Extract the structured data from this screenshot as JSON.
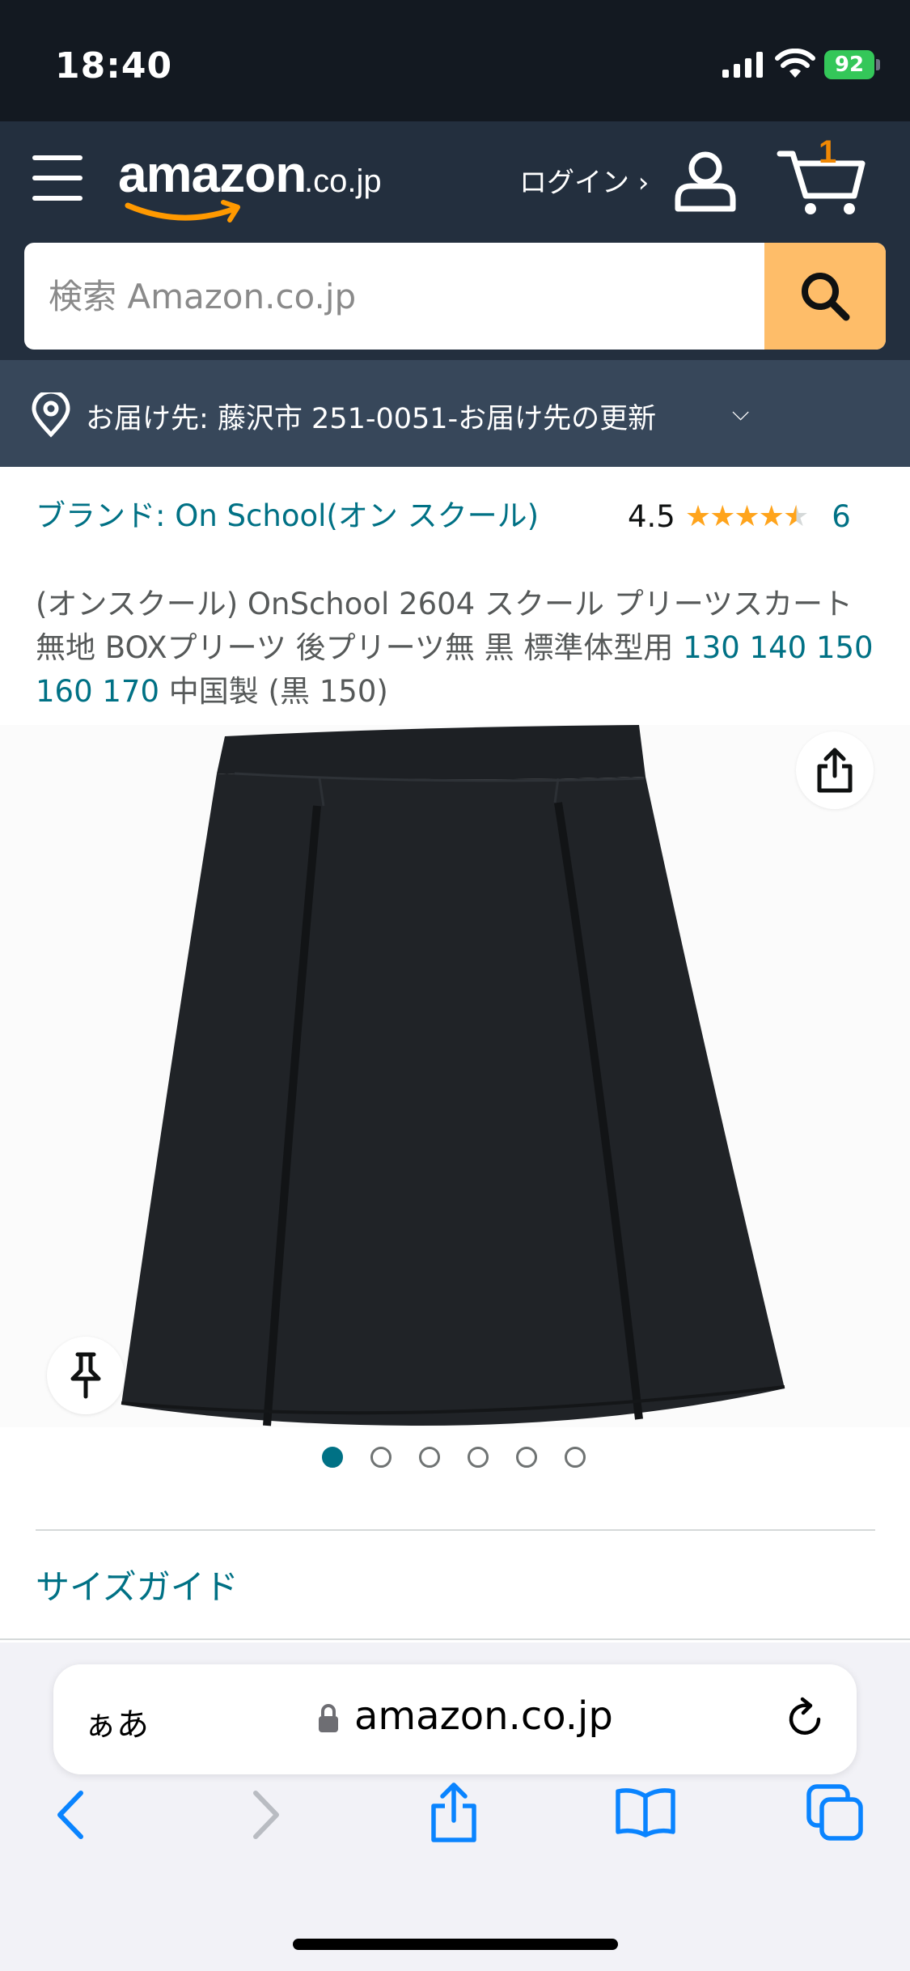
{
  "status_bar": {
    "time": "18:40",
    "battery": "92"
  },
  "header": {
    "logo_word": "amazon",
    "logo_tld": ".co.jp",
    "login_label": "ログイン ›",
    "cart_count": "1",
    "search_placeholder": "検索 Amazon.co.jp"
  },
  "delivery": {
    "text": "お届け先: 藤沢市 251-0051‐お届け先の更新",
    "chevron": "⌵"
  },
  "product": {
    "brand": "ブランド: On School(オン スクール)",
    "rating_value": "4.5",
    "rating_count": "6",
    "stars": {
      "full": "★★★★",
      "half": "★",
      "empty": ""
    },
    "title_main": "(オンスクール) OnSchool 2604 スクール プリーツスカート 無地 BOXプリーツ 後プリーツ無 黒 標準体型用 ",
    "title_sizes": "130 140 150 160 170",
    "title_tail": " 中国製 (黒 150)",
    "image_count": 6,
    "active_image_index": 1,
    "size_guide_label": "サイズガイド"
  },
  "safari": {
    "aa_label": "ぁあ",
    "url": "amazon.co.jp"
  },
  "icons": {
    "share": "share-icon",
    "pin": "pin-icon",
    "location": "location-pin-icon"
  },
  "colors": {
    "nav_bg": "#232f3e",
    "status_bg": "#131921",
    "delivery_bg": "#37475a",
    "link": "#007185",
    "search_button": "#febd69",
    "star": "#ffa41c",
    "cart_count": "#f08804"
  }
}
